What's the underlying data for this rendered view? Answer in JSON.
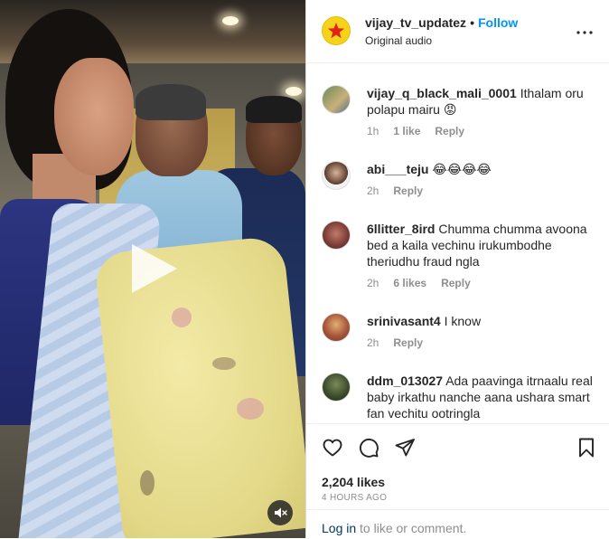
{
  "media": {
    "play_icon": "play-icon",
    "mute_icon": "speaker-muted-icon"
  },
  "header": {
    "username": "vijay_tv_updatez",
    "separator": "•",
    "follow_label": "Follow",
    "audio": "Original audio",
    "more_icon": "more-horizontal-icon"
  },
  "comments": [
    {
      "username": "vijay_q_black_mali_0001",
      "text": "Ithalam oru polapu mairu 😡",
      "time": "1h",
      "likes": "1 like",
      "reply": "Reply"
    },
    {
      "username": "abi___teju",
      "text": "😂😂😂😂",
      "time": "2h",
      "likes": "",
      "reply": "Reply"
    },
    {
      "username": "6llitter_8ird",
      "text": "Chumma chumma avoona bed a kaila vechinu irukumbodhe theriudhu fraud ngla",
      "time": "2h",
      "likes": "6 likes",
      "reply": "Reply"
    },
    {
      "username": "srinivasant4",
      "text": "I know",
      "time": "2h",
      "likes": "",
      "reply": "Reply"
    },
    {
      "username": "ddm_013027",
      "text": "Ada paavinga itrnaalu real baby irkathu nanche aana ushara smart fan vechitu ootringla",
      "time": "",
      "likes": "",
      "reply": ""
    }
  ],
  "actions": {
    "like_icon": "heart-icon",
    "comment_icon": "comment-icon",
    "share_icon": "send-icon",
    "save_icon": "bookmark-icon",
    "likes": "2,204 likes",
    "timestamp": "4 HOURS AGO"
  },
  "footer": {
    "login_link": "Log in",
    "login_rest": " to like or comment."
  },
  "colors": {
    "accent": "#0095f6",
    "text": "#262626",
    "muted": "#8e8e8e",
    "link_dark": "#00376b",
    "avatar_brand": "#f7d21c"
  }
}
